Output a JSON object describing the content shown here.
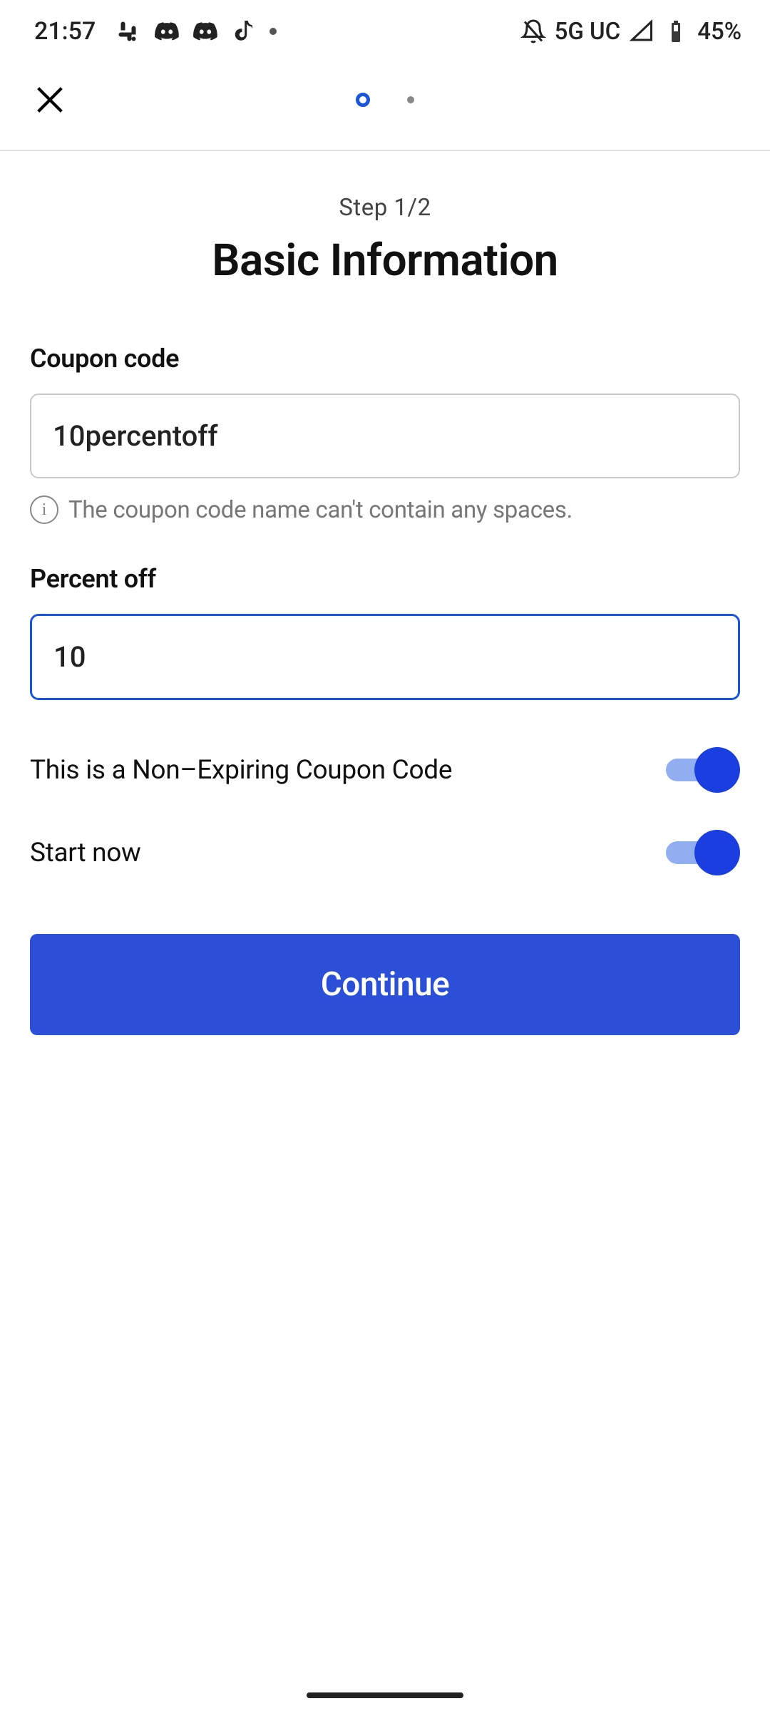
{
  "status_bar": {
    "time": "21:57",
    "network": "5G UC",
    "battery": "45%"
  },
  "header": {
    "step_label": "Step 1/2",
    "title": "Basic Information"
  },
  "form": {
    "coupon_code": {
      "label": "Coupon code",
      "value": "10percentoff",
      "hint": "The coupon code name can't contain any spaces."
    },
    "percent_off": {
      "label": "Percent off",
      "value": "10"
    },
    "non_expiring": {
      "label": "This is a Non–Expiring Coupon Code",
      "on": true
    },
    "start_now": {
      "label": "Start now",
      "on": true
    },
    "continue_label": "Continue"
  }
}
